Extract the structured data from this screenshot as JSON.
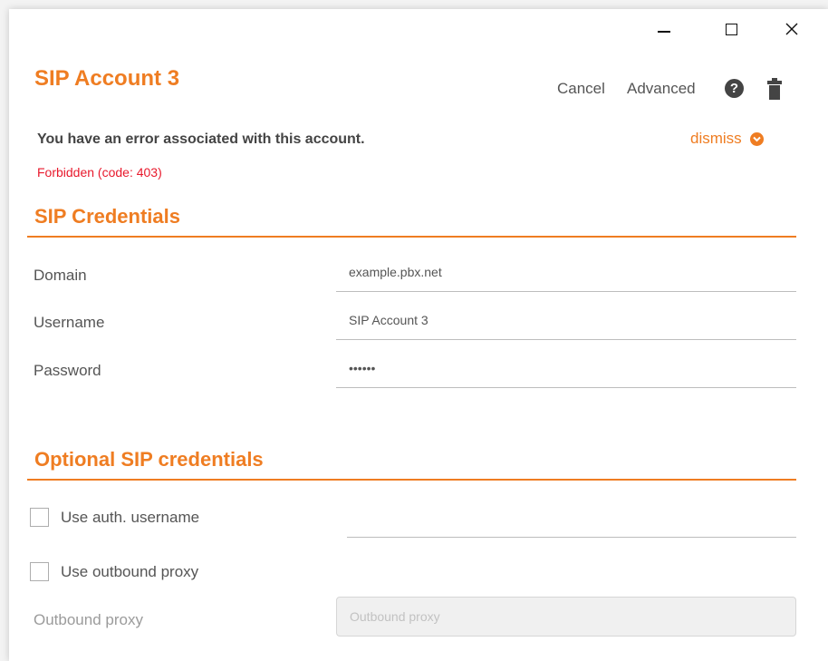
{
  "window": {
    "controls": {
      "minimize": "minimize",
      "maximize": "maximize",
      "close": "close"
    }
  },
  "header": {
    "title": "SIP Account 3",
    "cancel_label": "Cancel",
    "advanced_label": "Advanced",
    "help_glyph": "?",
    "icons": {
      "help": "help-icon",
      "delete": "trash-icon"
    }
  },
  "error": {
    "title": "You have an error associated with this account.",
    "detail": "Forbidden (code: 403)",
    "dismiss_label": "dismiss"
  },
  "sip_credentials": {
    "title": "SIP Credentials",
    "fields": [
      {
        "label": "Domain",
        "value": "example.pbx.net"
      },
      {
        "label": "Username",
        "value": "SIP Account 3"
      },
      {
        "label": "Password",
        "value": "••••••"
      }
    ]
  },
  "optional_credentials": {
    "title": "Optional SIP credentials",
    "use_auth_username_label": "Use auth. username",
    "use_auth_username_checked": false,
    "use_outbound_proxy_label": "Use outbound proxy",
    "use_outbound_proxy_checked": false,
    "outbound_proxy_label": "Outbound proxy",
    "outbound_proxy_placeholder": "Outbound proxy"
  },
  "colors": {
    "accent": "#ef7d22",
    "error": "#e8192c",
    "text": "#555555"
  }
}
